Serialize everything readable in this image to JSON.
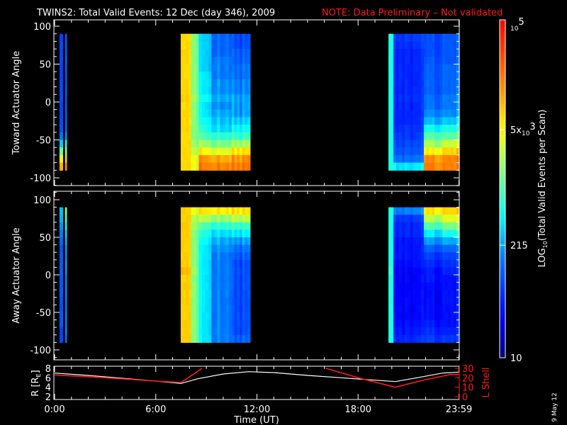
{
  "title": "TWINS2: Total Valid Events: 12 Dec (day 346), 2009",
  "note": "NOTE: Data Preliminary – Not validated",
  "date_stamp": "9 May 12",
  "colors": {
    "note": "#ff1a1a",
    "r_curve": "#ffffff",
    "l_curve": "#ff1a1a",
    "background": "#000000"
  },
  "chart_data": [
    {
      "type": "heatmap",
      "name": "toward",
      "ylabel": "Toward Actuator Angle",
      "ylim": [
        -110,
        110
      ],
      "yticks": [
        "100",
        "50",
        "0",
        "-50",
        "-100"
      ],
      "ytick_values": [
        100,
        50,
        0,
        -50,
        -100
      ],
      "angle_bins_top_to_bottom": [
        85,
        75,
        65,
        55,
        45,
        35,
        25,
        15,
        5,
        -5,
        -15,
        -25,
        -35,
        -45,
        -55,
        -65,
        -75,
        -85
      ],
      "value_units": "log10(events per scan)",
      "columns": [
        {
          "t": [
            0.29,
            0.48
          ],
          "v": [
            2.0,
            2.0,
            2.0,
            2.0,
            2.0,
            2.0,
            2.0,
            2.0,
            2.0,
            2.0,
            2.0,
            2.0,
            2.1,
            2.3,
            2.6,
            3.2,
            3.9,
            4.2
          ]
        },
        {
          "t": [
            0.62,
            0.71
          ],
          "v": [
            2.1,
            2.1,
            2.1,
            2.1,
            2.1,
            2.1,
            2.1,
            2.1,
            2.1,
            2.1,
            2.1,
            2.1,
            2.2,
            2.4,
            2.8,
            3.4,
            4.0,
            4.3
          ]
        },
        {
          "t": [
            7.48,
            8.1
          ],
          "v": [
            3.75,
            3.75,
            3.75,
            3.75,
            3.75,
            3.75,
            3.75,
            3.75,
            3.8,
            3.75,
            3.75,
            3.75,
            3.75,
            3.75,
            3.75,
            3.75,
            3.75,
            3.75
          ]
        },
        {
          "t": [
            8.1,
            8.55
          ],
          "v": [
            3.2,
            3.2,
            3.2,
            3.2,
            3.2,
            3.2,
            3.2,
            3.2,
            3.3,
            3.2,
            3.2,
            3.2,
            3.2,
            3.2,
            3.3,
            3.4,
            3.6,
            3.6
          ]
        },
        {
          "t": [
            8.55,
            9.3
          ],
          "v": [
            2.5,
            2.5,
            2.5,
            2.5,
            2.5,
            2.6,
            2.6,
            2.6,
            2.7,
            2.6,
            2.6,
            2.7,
            2.8,
            3.0,
            3.3,
            3.7,
            4.2,
            4.3
          ]
        },
        {
          "t": [
            9.3,
            10.5
          ],
          "v": [
            2.1,
            2.1,
            2.1,
            2.2,
            2.2,
            2.2,
            2.3,
            2.3,
            2.4,
            2.3,
            2.4,
            2.5,
            2.6,
            2.9,
            3.2,
            3.6,
            4.1,
            4.3
          ]
        },
        {
          "t": [
            10.5,
            11.6
          ],
          "v": [
            1.9,
            1.9,
            2.0,
            2.0,
            2.1,
            2.1,
            2.2,
            2.2,
            2.3,
            2.3,
            2.3,
            2.5,
            2.7,
            2.9,
            3.3,
            3.8,
            4.2,
            4.3
          ]
        },
        {
          "t": [
            19.8,
            20.1
          ],
          "v": [
            2.8,
            2.8,
            2.8,
            2.8,
            2.8,
            2.8,
            2.8,
            2.8,
            2.8,
            2.8,
            2.8,
            2.8,
            2.8,
            2.8,
            2.8,
            2.8,
            2.8,
            2.8
          ]
        },
        {
          "t": [
            20.1,
            21.9
          ],
          "v": [
            1.8,
            1.75,
            1.7,
            1.7,
            1.7,
            1.7,
            1.7,
            1.7,
            1.75,
            1.7,
            1.7,
            1.7,
            1.75,
            1.8,
            1.9,
            1.95,
            2.1,
            2.6
          ]
        },
        {
          "t": [
            21.9,
            23.0
          ],
          "v": [
            1.9,
            1.9,
            1.9,
            1.95,
            2.0,
            2.0,
            2.0,
            2.0,
            2.1,
            2.1,
            2.2,
            2.4,
            2.7,
            3.0,
            3.3,
            3.7,
            4.2,
            4.3
          ]
        },
        {
          "t": [
            23.0,
            24.0
          ],
          "v": [
            2.0,
            2.0,
            2.0,
            2.0,
            2.1,
            2.1,
            2.1,
            2.1,
            2.2,
            2.2,
            2.3,
            2.5,
            2.8,
            3.1,
            3.5,
            3.9,
            4.3,
            4.3
          ]
        }
      ]
    },
    {
      "type": "heatmap",
      "name": "away",
      "ylabel": "Away Actuator Angle",
      "ylim": [
        -110,
        110
      ],
      "yticks": [
        "100",
        "50",
        "0",
        "-50",
        "-100"
      ],
      "ytick_values": [
        100,
        50,
        0,
        -50,
        -100
      ],
      "angle_bins_top_to_bottom": [
        85,
        75,
        65,
        55,
        45,
        35,
        25,
        15,
        5,
        -5,
        -15,
        -25,
        -35,
        -45,
        -55,
        -65,
        -75,
        -85
      ],
      "value_units": "log10(events per scan)",
      "columns": [
        {
          "t": [
            0.29,
            0.48
          ],
          "v": [
            2.6,
            2.5,
            2.4,
            2.3,
            2.2,
            2.1,
            2.1,
            2.1,
            2.1,
            2.1,
            2.1,
            2.1,
            2.1,
            2.1,
            2.1,
            2.1,
            2.0,
            2.0
          ]
        },
        {
          "t": [
            0.62,
            0.71
          ],
          "v": [
            3.4,
            3.1,
            2.8,
            2.6,
            2.5,
            2.4,
            2.4,
            2.4,
            2.4,
            2.3,
            2.3,
            2.3,
            2.3,
            2.3,
            2.3,
            2.3,
            2.3,
            2.2
          ]
        },
        {
          "t": [
            7.48,
            8.1
          ],
          "v": [
            3.8,
            3.8,
            3.8,
            3.8,
            3.8,
            3.8,
            3.8,
            3.8,
            3.9,
            3.8,
            3.8,
            3.8,
            3.8,
            3.8,
            3.8,
            3.8,
            3.8,
            3.8
          ]
        },
        {
          "t": [
            8.1,
            8.55
          ],
          "v": [
            3.6,
            3.4,
            3.3,
            3.2,
            3.2,
            3.2,
            3.2,
            3.2,
            3.3,
            3.2,
            3.2,
            3.2,
            3.2,
            3.2,
            3.2,
            3.2,
            3.2,
            3.2
          ]
        },
        {
          "t": [
            8.55,
            9.3
          ],
          "v": [
            3.8,
            3.4,
            3.0,
            2.8,
            2.7,
            2.6,
            2.6,
            2.6,
            2.6,
            2.6,
            2.6,
            2.6,
            2.6,
            2.6,
            2.6,
            2.6,
            2.6,
            2.6
          ]
        },
        {
          "t": [
            9.3,
            10.5
          ],
          "v": [
            3.8,
            3.3,
            2.9,
            2.6,
            2.4,
            2.3,
            2.2,
            2.2,
            2.2,
            2.2,
            2.2,
            2.2,
            2.2,
            2.2,
            2.2,
            2.2,
            2.2,
            2.2
          ]
        },
        {
          "t": [
            10.5,
            11.6
          ],
          "v": [
            3.8,
            3.4,
            2.9,
            2.6,
            2.3,
            2.1,
            2.0,
            1.9,
            1.9,
            1.9,
            1.9,
            1.9,
            1.9,
            1.9,
            1.9,
            1.9,
            1.9,
            2.0
          ]
        },
        {
          "t": [
            19.8,
            20.1
          ],
          "v": [
            2.8,
            2.8,
            2.8,
            2.8,
            2.8,
            2.8,
            2.8,
            2.8,
            2.9,
            2.8,
            2.8,
            2.8,
            2.8,
            2.8,
            2.8,
            2.8,
            2.8,
            2.8
          ]
        },
        {
          "t": [
            20.1,
            21.9
          ],
          "v": [
            2.2,
            1.8,
            1.7,
            1.7,
            1.6,
            1.6,
            1.6,
            1.55,
            1.5,
            1.5,
            1.5,
            1.5,
            1.5,
            1.5,
            1.5,
            1.55,
            1.6,
            1.7
          ]
        },
        {
          "t": [
            21.9,
            23.0
          ],
          "v": [
            3.8,
            3.4,
            3.0,
            2.6,
            2.3,
            2.0,
            1.8,
            1.7,
            1.6,
            1.6,
            1.5,
            1.5,
            1.5,
            1.5,
            1.5,
            1.6,
            1.7,
            1.8
          ]
        },
        {
          "t": [
            23.0,
            24.0
          ],
          "v": [
            3.9,
            3.6,
            3.2,
            2.8,
            2.4,
            2.1,
            1.9,
            1.8,
            1.7,
            1.6,
            1.6,
            1.6,
            1.6,
            1.6,
            1.6,
            1.6,
            1.7,
            1.8
          ]
        }
      ]
    },
    {
      "type": "line",
      "name": "orbit",
      "ylabel": "R [RE]",
      "ylabel_main": "R [R",
      "ylabel_sub": "E",
      "ylabel_end": "]",
      "y2label": "L Shell",
      "xlabel": "Time (UT)",
      "xlim": [
        0,
        24
      ],
      "xticks": [
        "0:00",
        "6:00",
        "12:00",
        "18:00",
        "23:59"
      ],
      "xtick_values": [
        0,
        6,
        12,
        18,
        23.98
      ],
      "ylim": [
        2,
        8
      ],
      "yticks": [
        "8",
        "6",
        "4",
        "2"
      ],
      "ytick_values": [
        8,
        6,
        4,
        2
      ],
      "y2lim": [
        0,
        30
      ],
      "y2ticks": [
        "30",
        "20",
        "10",
        "0"
      ],
      "y2tick_values": [
        30,
        20,
        10,
        0
      ],
      "series": [
        {
          "name": "R",
          "axis": "left",
          "points": [
            [
              0,
              7.0
            ],
            [
              2,
              6.5
            ],
            [
              4,
              5.9
            ],
            [
              6,
              5.3
            ],
            [
              7.5,
              4.8
            ],
            [
              8.5,
              5.8
            ],
            [
              10,
              6.8
            ],
            [
              11.5,
              7.3
            ],
            [
              13,
              7.1
            ],
            [
              15,
              6.5
            ],
            [
              17,
              6.0
            ],
            [
              19,
              5.5
            ],
            [
              20.2,
              5.2
            ],
            [
              21.5,
              6.0
            ],
            [
              23,
              7.0
            ],
            [
              24,
              7.2
            ]
          ]
        },
        {
          "name": "L Shell (pre-apogee)",
          "axis": "right",
          "points": [
            [
              0,
              23
            ],
            [
              3,
              20
            ],
            [
              6,
              16.5
            ],
            [
              7.5,
              15
            ],
            [
              8.75,
              30
            ]
          ]
        },
        {
          "name": "L Shell (post-apogee)",
          "axis": "right",
          "points": [
            [
              16.1,
              30
            ],
            [
              18,
              20
            ],
            [
              20.2,
              10
            ],
            [
              22,
              18
            ],
            [
              23.5,
              23.5
            ],
            [
              24,
              23.5
            ]
          ]
        }
      ]
    },
    {
      "type": "colorbar",
      "label_main": "LOG",
      "label_sub": "10",
      "label_rest": "(Total Valid Events per Scan)",
      "range_log10": [
        1,
        5
      ],
      "ticks": [
        {
          "value_log10": 5,
          "base": "10",
          "exp": "5",
          "prefix": ""
        },
        {
          "value_log10": 3.699,
          "base": "10",
          "exp": "3",
          "prefix": "5x"
        },
        {
          "value_log10": 2.332,
          "label": "215"
        },
        {
          "value_log10": 1,
          "label": "10"
        }
      ]
    }
  ]
}
